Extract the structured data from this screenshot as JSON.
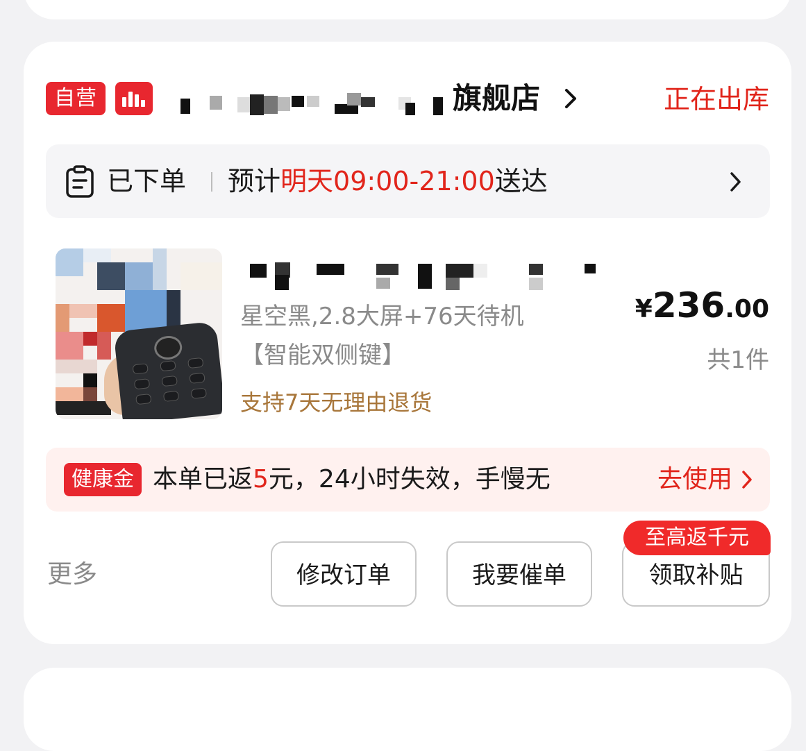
{
  "order": {
    "self_operated_badge": "自营",
    "shop_name_suffix": "旗舰店",
    "status": "正在出库"
  },
  "delivery": {
    "placed": "已下单",
    "estimate_prefix": "预计",
    "estimate_time": "明天09:00-21:00",
    "estimate_suffix": "送达"
  },
  "product": {
    "spec_line1": "星空黑,2.8大屏+76天待机",
    "spec_line2": "【智能双侧键】",
    "return_policy": "支持7天无理由退货",
    "price_currency": "¥",
    "price_integer": "236",
    "price_decimal": ".00",
    "quantity": "共1件"
  },
  "health_gold": {
    "badge": "健康金",
    "text_prefix": "本单已返",
    "amount": "5",
    "text_suffix": "元，24小时失效，手慢无",
    "cta": "去使用"
  },
  "actions": {
    "more": "更多",
    "modify": "修改订单",
    "urge": "我要催单",
    "subsidy": "领取补贴",
    "subsidy_promo": "至高返千元"
  },
  "colors": {
    "brand_red": "#e1251b",
    "badge_red": "#e8272f",
    "return_gold": "#a8763a"
  }
}
